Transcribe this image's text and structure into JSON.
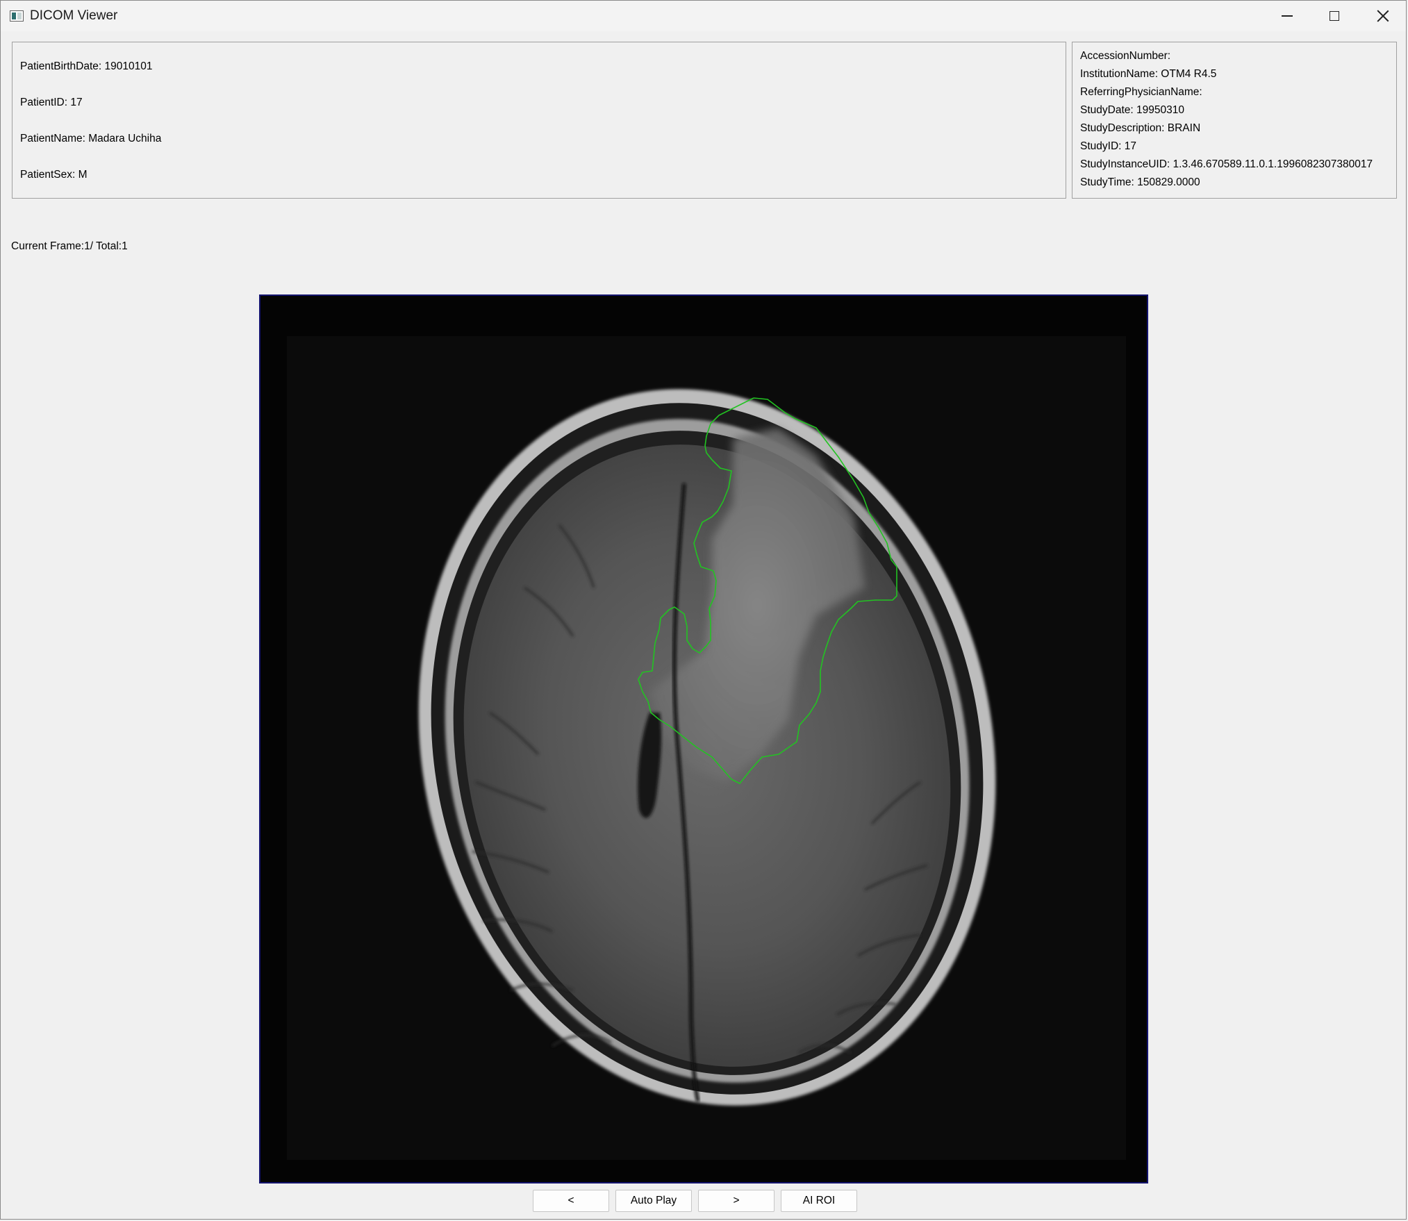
{
  "window": {
    "title": "DICOM Viewer"
  },
  "patient_info": {
    "birth_date": "PatientBirthDate: 19010101",
    "id": "PatientID: 17",
    "name": "PatientName: Madara Uchiha",
    "sex": "PatientSex: M"
  },
  "study_info": {
    "accession_number": "AccessionNumber:",
    "institution_name": "InstitutionName: OTM4 R4.5",
    "referring_physician": "ReferringPhysicianName:",
    "study_date": "StudyDate: 19950310",
    "study_description": "StudyDescription: BRAIN",
    "study_id": "StudyID: 17",
    "study_instance_uid": "StudyInstanceUID: 1.3.46.670589.11.0.1.1996082307380017",
    "study_time": "StudyTime: 150829.0000"
  },
  "frame_info": {
    "label": "Current Frame:1/ Total:1"
  },
  "image": {
    "roi_color": "#22c322"
  },
  "controls": {
    "prev_label": "<",
    "autoplay_label": "Auto Play",
    "next_label": ">",
    "ai_roi_label": "AI ROI"
  }
}
